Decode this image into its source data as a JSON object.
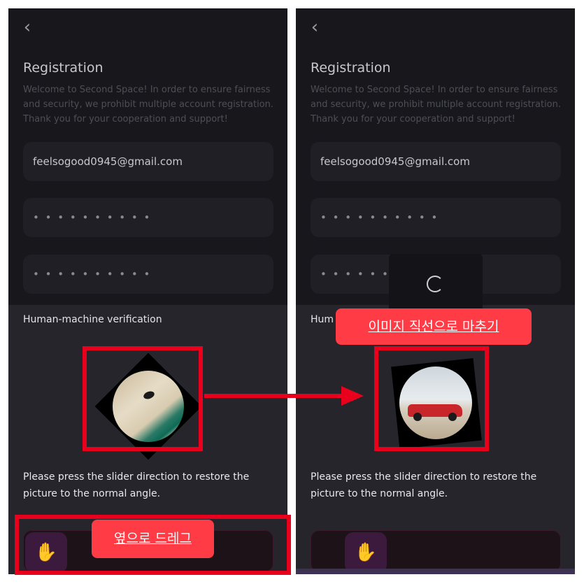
{
  "screens": [
    {
      "back_icon": "‹",
      "title": "Registration",
      "welcome": "Welcome to Second Space! In order to ensure fairness and security, we prohibit multiple account registration. Thank you for your cooperation and support!",
      "email_value": "feelsogood0945@gmail.com",
      "password_mask": "• • • • • • • • • •",
      "confirm_mask": "• • • • • • • • • •",
      "verification_title": "Human-machine verification",
      "instruction": "Please press the slider direction to restore the picture to the normal angle.",
      "slider_icon": "✋",
      "slider_progress": 0.0
    },
    {
      "back_icon": "‹",
      "title": "Registration",
      "welcome": "Welcome to Second Space! In order to ensure fairness and security, we prohibit multiple account registration. Thank you for your cooperation and support!",
      "email_value": "feelsogood0945@gmail.com",
      "password_mask": "• • • • • • • • • •",
      "confirm_mask": "• • • • • • • • • •",
      "verification_title": "Hum",
      "instruction": "Please press the slider direction to restore the picture to the normal angle.",
      "slider_icon": "✋",
      "slider_progress": 0.17
    }
  ],
  "annotations": {
    "drag_sideways": "옆으로 드레그",
    "align_image": "이미지 직선으로 마추기"
  },
  "colors": {
    "annotation_red": "#e8001d",
    "annotation_label": "#ff3b46",
    "panel_bg": "#17171c"
  }
}
